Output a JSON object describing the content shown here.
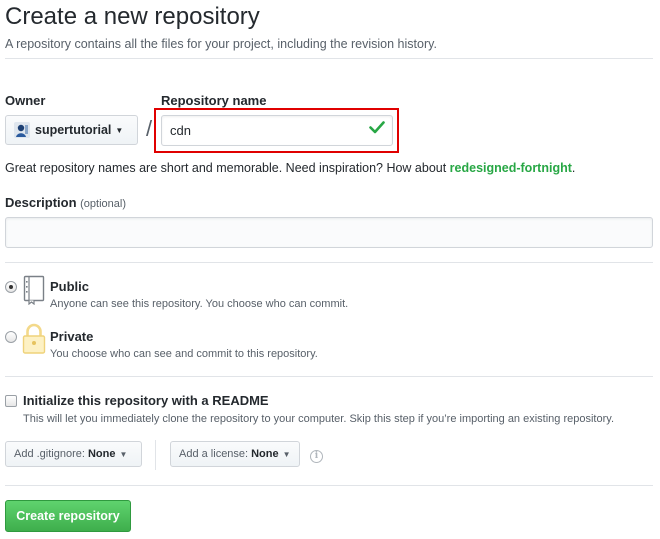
{
  "header": {
    "title": "Create a new repository",
    "subtitle": "A repository contains all the files for your project, including the revision history."
  },
  "owner": {
    "label": "Owner",
    "value": "supertutorial"
  },
  "separator": "/",
  "repo_name": {
    "label": "Repository name",
    "value": "cdn",
    "valid": true
  },
  "hint": {
    "text": "Great repository names are short and memorable. Need inspiration? How about ",
    "suggestion": "redesigned-fortnight",
    "end": "."
  },
  "description": {
    "label": "Description",
    "optional": "(optional)",
    "value": ""
  },
  "visibility": {
    "selected": "public",
    "public": {
      "title": "Public",
      "desc": "Anyone can see this repository. You choose who can commit."
    },
    "private": {
      "title": "Private",
      "desc": "You choose who can see and commit to this repository."
    }
  },
  "readme": {
    "checked": false,
    "label": "Initialize this repository with a README",
    "desc": "This will let you immediately clone the repository to your computer. Skip this step if you’re importing an existing repository."
  },
  "gitignore": {
    "label": "Add .gitignore:",
    "value": "None"
  },
  "license": {
    "label": "Add a license:",
    "value": "None"
  },
  "submit": {
    "label": "Create repository"
  },
  "colors": {
    "accent_green": "#28a745",
    "highlight_red": "#e00000"
  }
}
